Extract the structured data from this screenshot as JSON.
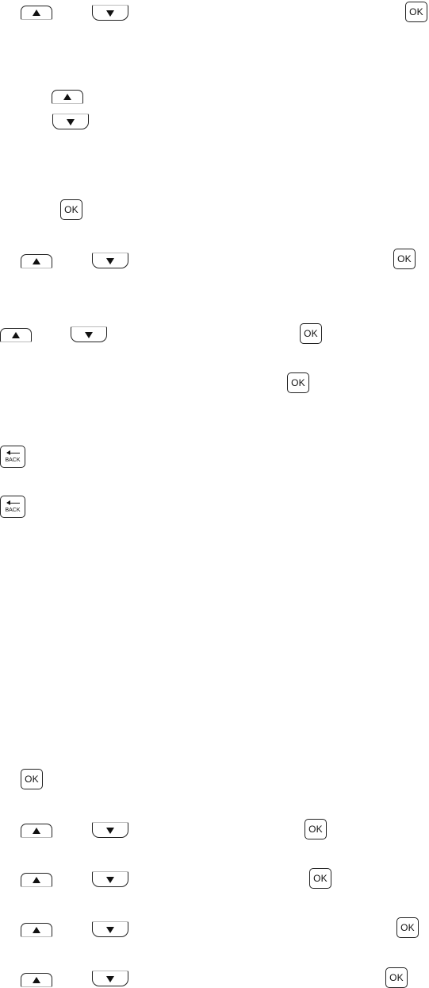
{
  "keys": {
    "ok_label": "OK",
    "back_label": "BACK",
    "up_icon": "triangle-up-icon",
    "down_icon": "triangle-down-icon",
    "back_icon": "left-arrow-icon"
  }
}
